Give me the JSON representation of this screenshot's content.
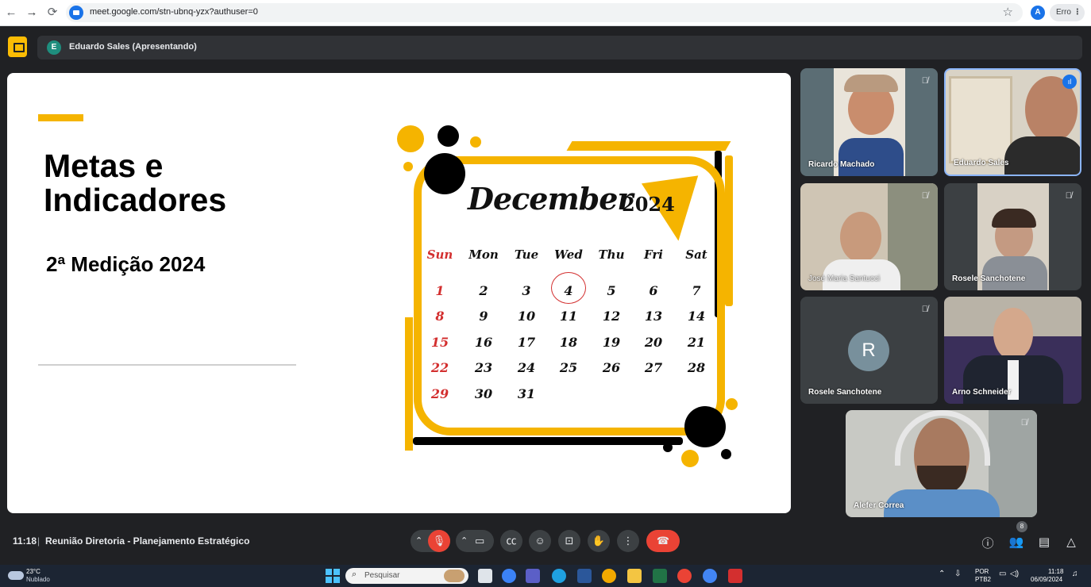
{
  "browser": {
    "url": "meet.google.com/stn-ubnq-yzx?authuser=0",
    "profile_letter": "A",
    "error_label": "Erro"
  },
  "meet_header": {
    "presenter_initial": "E",
    "presenter_label": "Eduardo Sales (Apresentando)"
  },
  "slide": {
    "title_line1": "Metas e",
    "title_line2": "Indicadores",
    "subtitle": "2ª Medição 2024",
    "calendar": {
      "month": "December",
      "year": "2024",
      "weekdays": [
        "Sun",
        "Mon",
        "Tue",
        "Wed",
        "Thu",
        "Fri",
        "Sat"
      ],
      "weeks": [
        [
          "1",
          "2",
          "3",
          "4",
          "5",
          "6",
          "7"
        ],
        [
          "8",
          "9",
          "10",
          "11",
          "12",
          "13",
          "14"
        ],
        [
          "15",
          "16",
          "17",
          "18",
          "19",
          "20",
          "21"
        ],
        [
          "22",
          "23",
          "24",
          "25",
          "26",
          "27",
          "28"
        ],
        [
          "29",
          "30",
          "31",
          "",
          "",
          "",
          ""
        ]
      ],
      "highlighted_day": "4"
    }
  },
  "participants": [
    {
      "name": "Ricardo Machado",
      "muted": true
    },
    {
      "name": "Eduardo Sales",
      "muted": false,
      "speaking": true
    },
    {
      "name": "José Maria Santucci",
      "muted": true
    },
    {
      "name": "Rosele Sanchotene",
      "muted": true
    },
    {
      "name": "Rosele Sanchotene",
      "muted": true,
      "avatar_letter": "R"
    },
    {
      "name": "Arno Schneider",
      "muted": false
    },
    {
      "name": "Alefer Correa",
      "muted": true
    }
  ],
  "bottom_bar": {
    "time": "11:18",
    "separator": "|",
    "meeting_title": "Reunião Diretoria - Planejamento Estratégico",
    "participant_count": "8"
  },
  "taskbar": {
    "temperature": "23°C",
    "weather": "Nublado",
    "search_placeholder": "Pesquisar",
    "language": "POR",
    "keyboard": "PTB2",
    "clock_time": "11:18",
    "clock_date": "06/09/2024"
  },
  "colors": {
    "accent_yellow": "#f5b400",
    "end_call_red": "#ea4335",
    "meet_bg": "#202124"
  }
}
